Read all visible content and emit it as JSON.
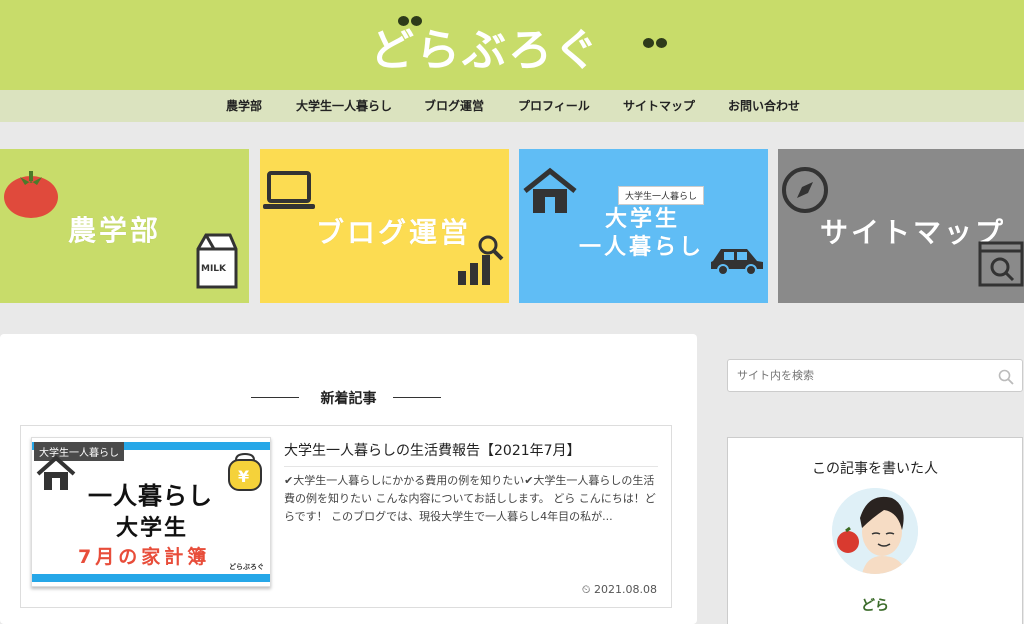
{
  "site": {
    "logo": "どらぶろぐ"
  },
  "nav": {
    "items": [
      "農学部",
      "大学生一人暮らし",
      "ブログ運営",
      "プロフィール",
      "サイトマップ",
      "お問い合わせ"
    ]
  },
  "banners": [
    {
      "label": "農学部",
      "icon": "tomato-and-milk-icon"
    },
    {
      "label": "ブログ運営",
      "icon": "laptop-and-chart-icon"
    },
    {
      "label_line1": "大学生",
      "label_line2": "一人暮らし",
      "tag": "大学生一人暮らし",
      "icon": "house-and-car-icon"
    },
    {
      "label": "サイトマップ",
      "icon": "compass-and-search-icon"
    }
  ],
  "main": {
    "section_title": "新着記事",
    "post": {
      "thumb_tag": "大学生一人暮らし",
      "thumb_line1": "一人暮らし",
      "thumb_line2": "大学生",
      "thumb_line3": "7月の家計簿",
      "thumb_logo": "どらぶろぐ",
      "title": "大学生一人暮らしの生活費報告【2021年7月】",
      "excerpt": "✔大学生一人暮らしにかかる費用の例を知りたい✔大学生一人暮らしの生活費の例を知りたい こんな内容についてお話しします。 どら こんにちは！どらです！ このブログでは、現役大学生で一人暮らし4年目の私が...",
      "date": "2021.08.08"
    }
  },
  "sidebar": {
    "search_placeholder": "サイト内を検索",
    "author_title": "この記事を書いた人",
    "author_name": "どら"
  },
  "colors": {
    "header": "#c8dc6a",
    "nav": "#dbe3bf",
    "banner_agri": "#c8dc6a",
    "banner_blog": "#fcdc52",
    "banner_life": "#60bdf5",
    "banner_map": "#8a8a8a"
  }
}
